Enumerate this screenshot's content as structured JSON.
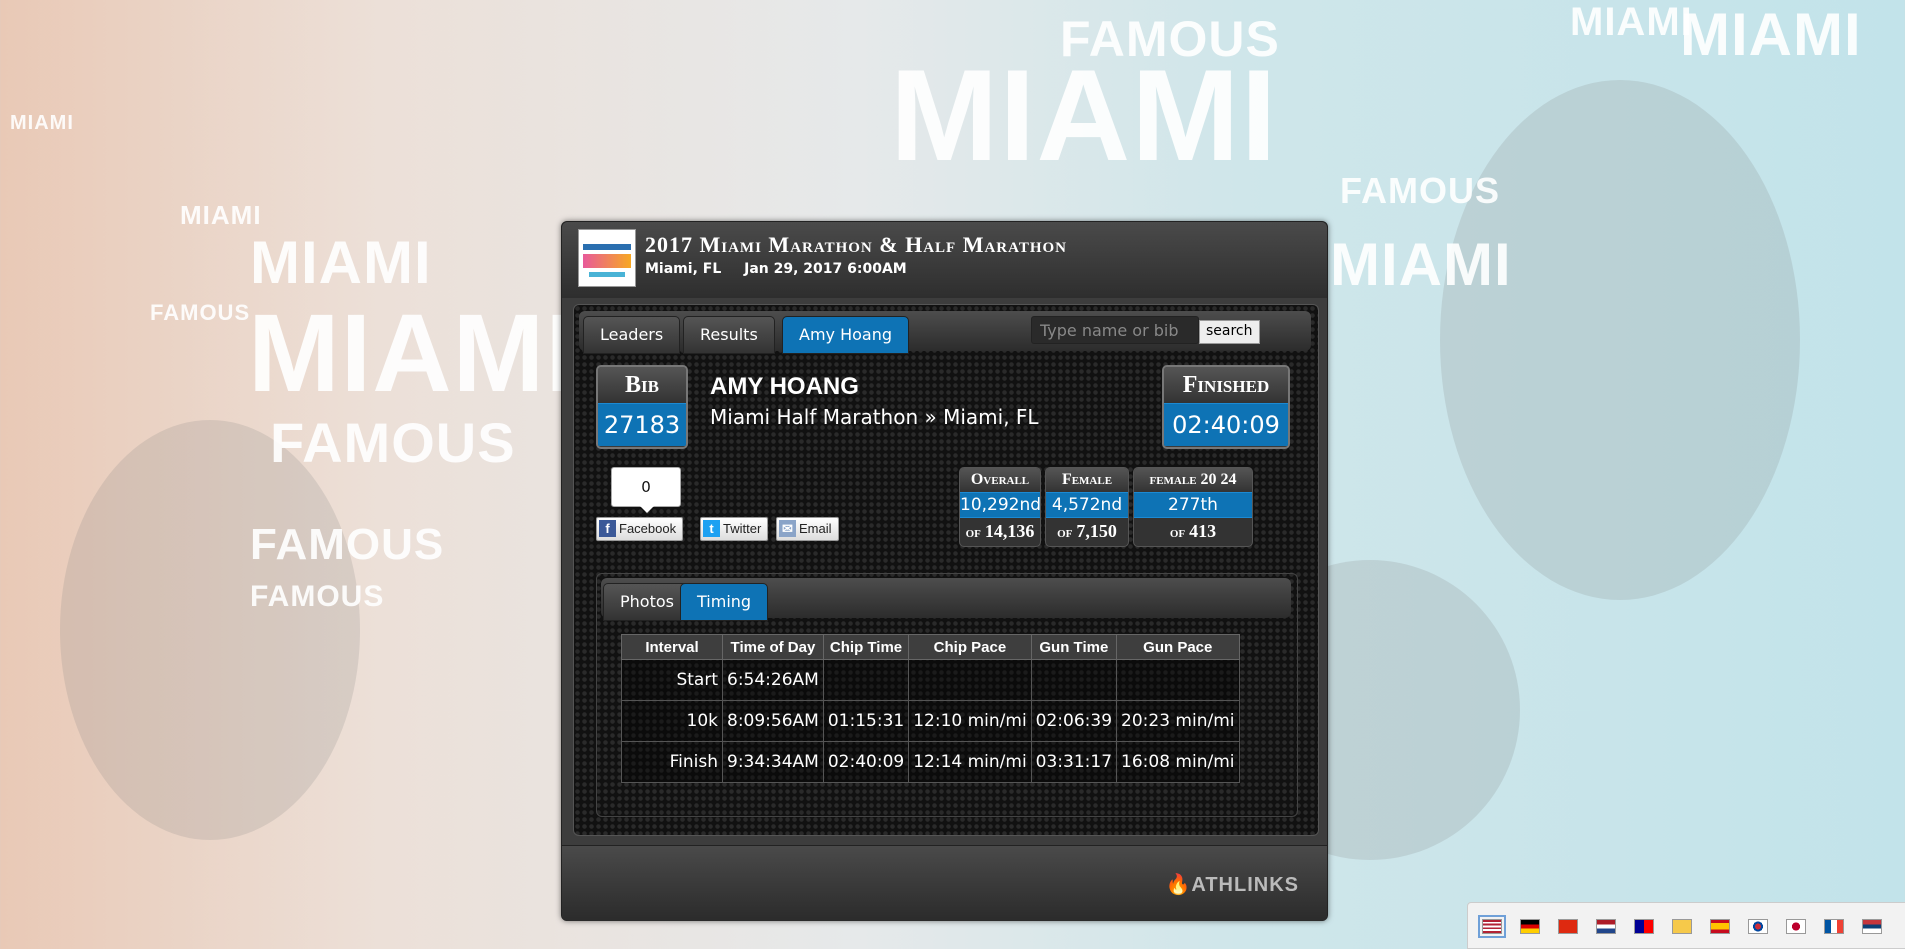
{
  "event": {
    "title": "2017 Miami Marathon & Half Marathon",
    "location": "Miami, FL",
    "date": "Jan 29, 2017 6:00AM"
  },
  "tabs": [
    {
      "label": "Leaders",
      "active": false
    },
    {
      "label": "Results",
      "active": false
    },
    {
      "label": "Amy Hoang",
      "active": true
    }
  ],
  "search": {
    "placeholder": "Type name or bib",
    "button_label": "search"
  },
  "athlete": {
    "bib_label": "Bib",
    "bib": "27183",
    "name": "AMY HOANG",
    "race": "Miami Half Marathon » Miami, FL",
    "finished_label": "Finished",
    "finish_time": "02:40:09"
  },
  "share": {
    "count": "0",
    "facebook": "Facebook",
    "twitter": "Twitter",
    "email": "Email"
  },
  "rankings": [
    {
      "label": "Overall",
      "place": "10,292nd",
      "of_label": "of",
      "total": "14,136"
    },
    {
      "label": "Female",
      "place": "4,572nd",
      "of_label": "of",
      "total": "7,150"
    },
    {
      "label": "female 20 24",
      "place": "277th",
      "of_label": "of",
      "total": "413"
    }
  ],
  "subtabs": [
    {
      "label": "Photos",
      "active": false
    },
    {
      "label": "Timing",
      "active": true
    }
  ],
  "timing": {
    "headers": [
      "Interval",
      "Time of Day",
      "Chip Time",
      "Chip Pace",
      "Gun Time",
      "Gun Pace"
    ],
    "rows": [
      [
        "Start",
        "6:54:26AM",
        "",
        "",
        "",
        ""
      ],
      [
        "10k",
        "8:09:56AM",
        "01:15:31",
        "12:10 min/mi",
        "02:06:39",
        "20:23 min/mi"
      ],
      [
        "Finish",
        "9:34:34AM",
        "02:40:09",
        "12:14 min/mi",
        "03:31:17",
        "16:08 min/mi"
      ]
    ]
  },
  "footer": {
    "brand": "ATHLINKS"
  },
  "background_text": {
    "word1": "MIAMI",
    "word2": "FAMOUS"
  },
  "colors": {
    "accent": "#0e73b5",
    "panel": "#3d3d3d"
  }
}
